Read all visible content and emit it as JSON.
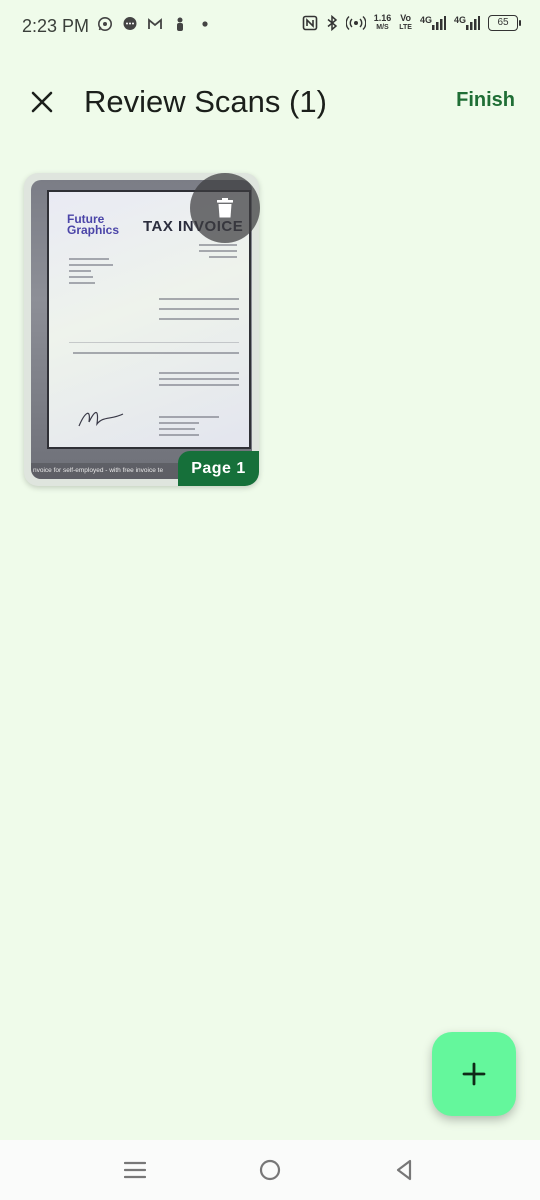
{
  "status_bar": {
    "time": "2:23 PM",
    "left_icons": [
      "whatsapp-icon",
      "chat-bubble-icon",
      "gmail-icon",
      "person-icon",
      "dot-icon"
    ],
    "right_icons": [
      "nfc-icon",
      "bluetooth-icon",
      "hotspot-icon"
    ],
    "speed_value": "1.16",
    "speed_unit": "M/S",
    "vo_label": "Vo",
    "lte_label": "LTE",
    "net1": "4G",
    "net2": "4G",
    "battery": "65"
  },
  "app_bar": {
    "close_icon": "close-icon",
    "title": "Review Scans (1)",
    "finish_label": "Finish"
  },
  "scans": [
    {
      "page_label": "Page 1",
      "thumbnail": {
        "brand_line1": "Future",
        "brand_line2": "Graphics",
        "doc_title": "TAX INVOICE",
        "caption": "nvoice for self-employed - with free invoice te"
      },
      "delete_icon": "trash-icon"
    }
  ],
  "fab": {
    "icon": "plus-icon"
  },
  "nav_bar": {
    "icons": [
      "menu-icon",
      "home-circle-icon",
      "back-triangle-icon"
    ]
  },
  "colors": {
    "background": "#effbea",
    "accent": "#1f6e35",
    "badge": "#16703a",
    "fab": "#64f79c"
  }
}
